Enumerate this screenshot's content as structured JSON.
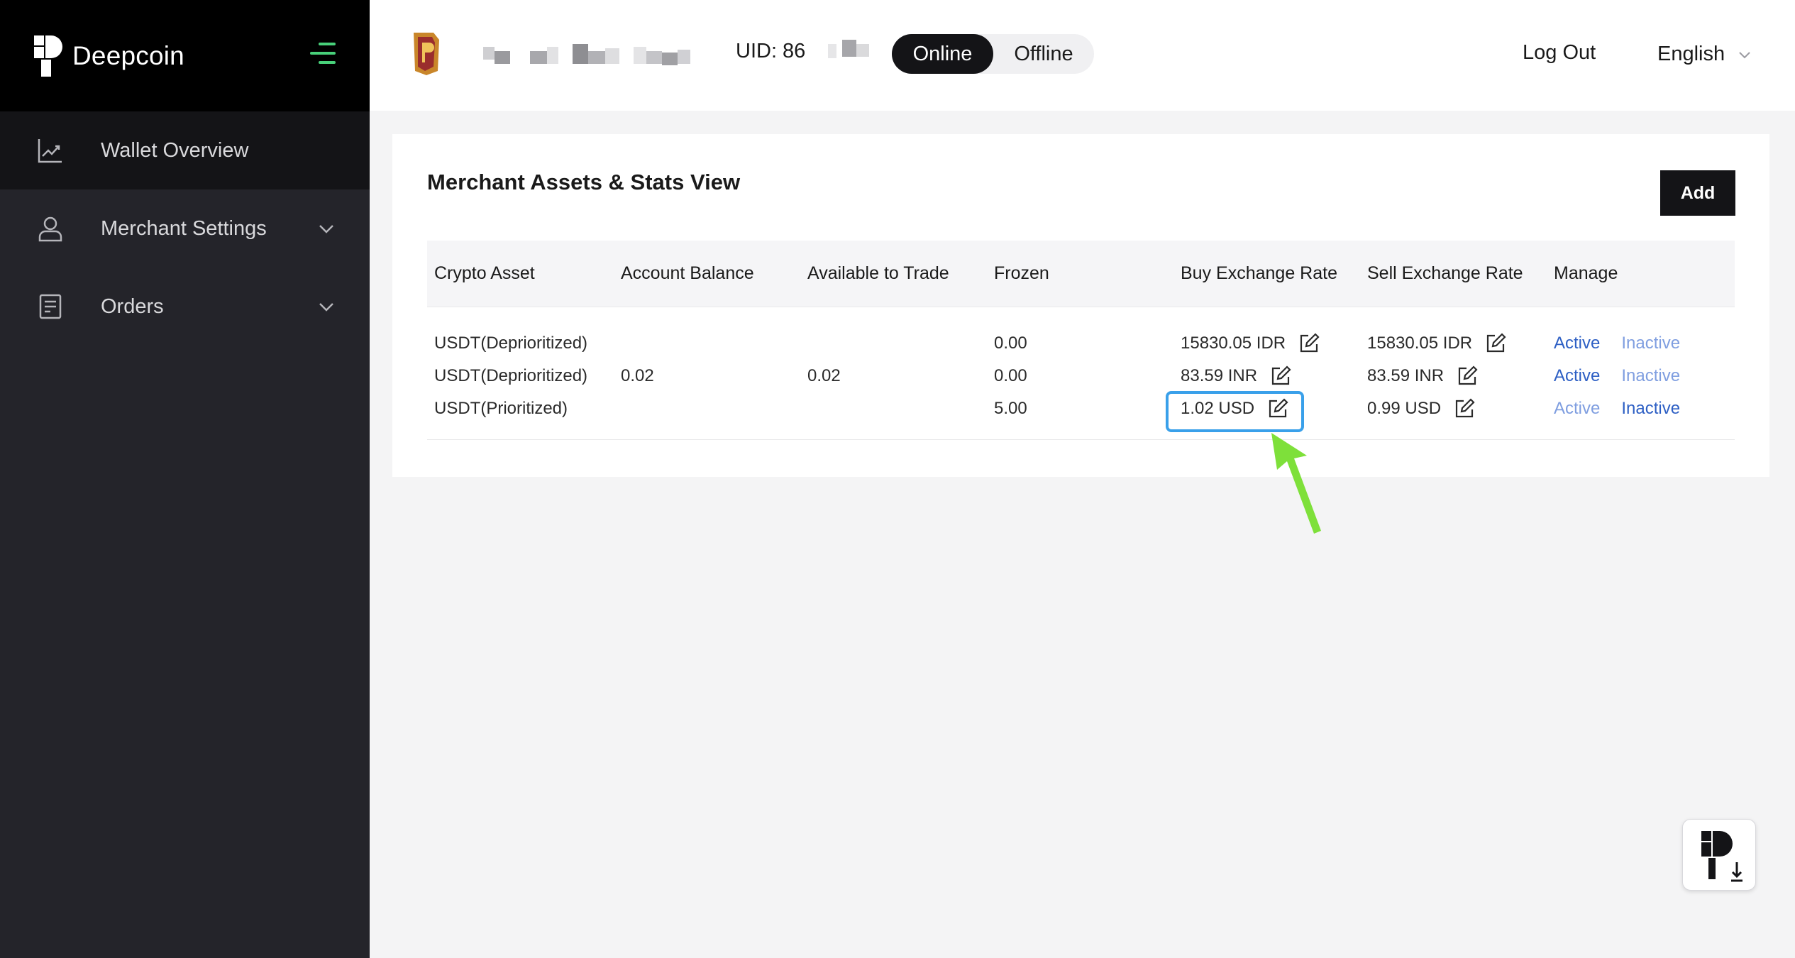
{
  "brand": {
    "name": "Deepcoin"
  },
  "sidebar": {
    "items": [
      {
        "label": "Wallet Overview",
        "icon": "chart-line-icon"
      },
      {
        "label": "Merchant Settings",
        "icon": "user-icon"
      },
      {
        "label": "Orders",
        "icon": "document-icon"
      }
    ]
  },
  "header": {
    "uid_label": "UID: 86",
    "status": {
      "online": "Online",
      "offline": "Offline",
      "selected": "Online"
    },
    "logout": "Log Out",
    "language": "English"
  },
  "card": {
    "title": "Merchant Assets & Stats View",
    "add_label": "Add"
  },
  "table": {
    "columns": [
      "Crypto Asset",
      "Account Balance",
      "Available to Trade",
      "Frozen",
      "Buy Exchange Rate",
      "Sell Exchange Rate",
      "Manage"
    ],
    "rows": [
      {
        "asset": "USDT(Deprioritized)",
        "balance": "",
        "available": "",
        "frozen": "0.00",
        "buy": "15830.05 IDR",
        "sell": "15830.05 IDR",
        "active": "Active",
        "inactive": "Inactive",
        "state": "active"
      },
      {
        "asset": "USDT(Deprioritized)",
        "balance": "0.02",
        "available": "0.02",
        "frozen": "0.00",
        "buy": "83.59 INR",
        "sell": "83.59 INR",
        "active": "Active",
        "inactive": "Inactive",
        "state": "active"
      },
      {
        "asset": "USDT(Prioritized)",
        "balance": "",
        "available": "",
        "frozen": "5.00",
        "buy": "1.02 USD",
        "sell": "0.99 USD",
        "active": "Active",
        "inactive": "Inactive",
        "state": "inactive"
      }
    ]
  },
  "colors": {
    "link": "#2d5fc4",
    "link_muted": "#7f9ee0",
    "highlight": "#39a0ea",
    "arrow": "#7ee03a"
  }
}
